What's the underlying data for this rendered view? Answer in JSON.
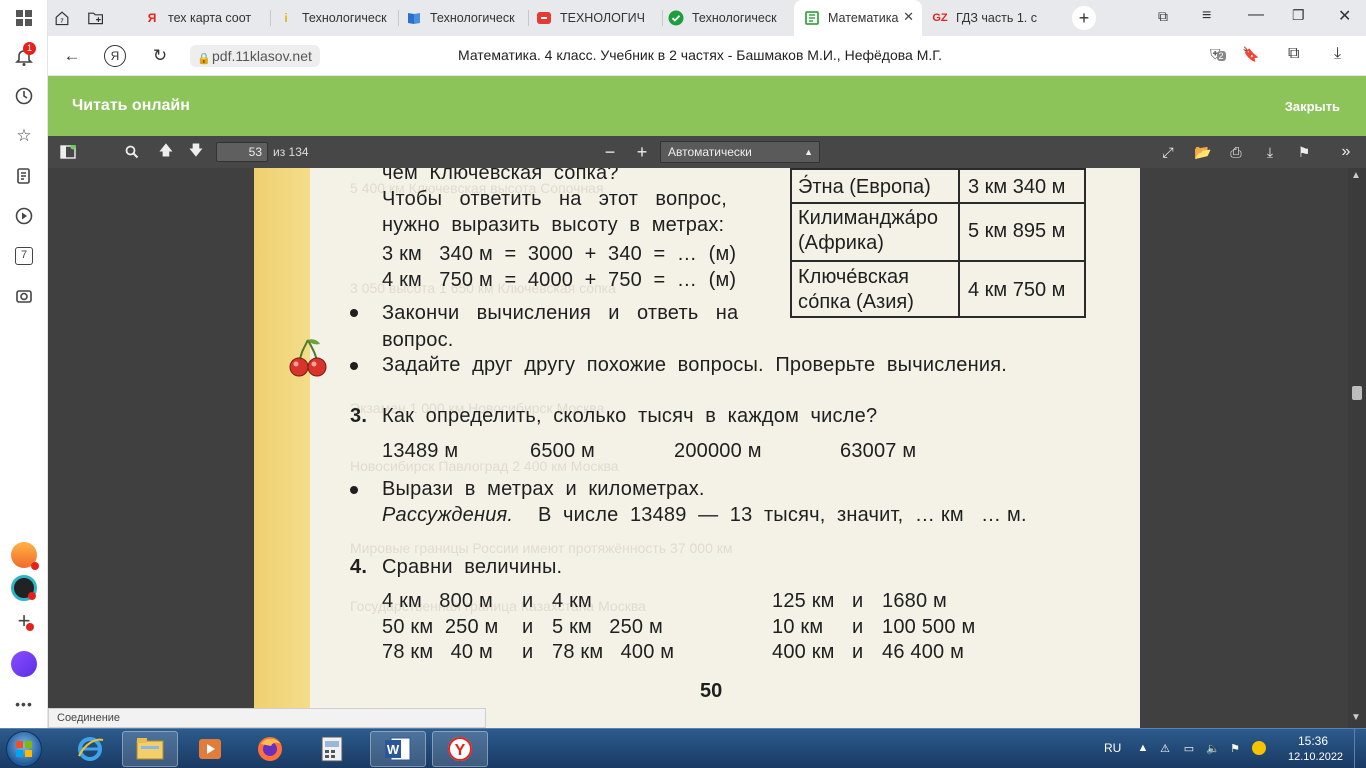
{
  "sidebar": {
    "notification_count": "1",
    "counter_label": "7"
  },
  "tabs": [
    {
      "label": "",
      "icon": "home-tab"
    },
    {
      "label": "тех карта соот",
      "icon": "yandex-y"
    },
    {
      "label": "Технологическ",
      "icon": "info-i"
    },
    {
      "label": "Технологическ",
      "icon": "book"
    },
    {
      "label": "ТЕХНОЛОГИЧ",
      "icon": "red-box"
    },
    {
      "label": "Технологическ",
      "icon": "green-check"
    },
    {
      "label": "Математика",
      "icon": "green-book",
      "active": true
    },
    {
      "label": "ГДЗ часть 1. с",
      "icon": "gdz"
    }
  ],
  "address": {
    "url": "pdf.11klasov.net",
    "title": "Математика. 4 класс. Учебник в 2 частях - Башмаков М.И., Нефёдова М.Г.",
    "lock_badge": "2"
  },
  "header": {
    "title": "Читать онлайн",
    "close": "Закрыть"
  },
  "pdf_toolbar": {
    "page": "53",
    "page_total": "из 134",
    "zoom": "Автоматически"
  },
  "book": {
    "lines": [
      "чем  Ключевская  сопка?",
      "Чтобы   ответить   на   этот   вопрос,",
      "нужно  выразить  высоту  в  метрах:",
      "3 км   340 м  =  3000  +  340  =  …  (м)",
      "4 км   750 м  =  4000  +  750  =  …  (м)",
      "Закончи   вычисления   и   ответь   на",
      "вопрос.",
      "Задайте  друг  другу  похожие  вопросы.  Проверьте  вычисления."
    ],
    "table": [
      {
        "name": "Э́тна (Европа)",
        "height": "3 км 340 м"
      },
      {
        "name": "Килиманджа́ро\n(Африка)",
        "height": "5 км 895 м"
      },
      {
        "name": "Ключе́вская\nсо́пка (Азия)",
        "height": "4 км 750 м"
      }
    ],
    "task3_num": "3.",
    "task3_text": "Как  определить,  сколько  тысяч  в  каждом  числе?",
    "numbers": [
      "13489 м",
      "6500 м",
      "200000 м",
      "63007 м"
    ],
    "bullet3": "Вырази  в  метрах  и  километрах.",
    "reasoning_label": "Рассуждения.",
    "reasoning_text": "В  числе  13489  —  13  тысяч,  значит,  … км   … м.",
    "task4_num": "4.",
    "task4_text": "Сравни  величины.",
    "compare_left": [
      [
        "4 км   800 м",
        "и",
        "4 км"
      ],
      [
        "50 км  250 м",
        "и",
        "5 км   250 м"
      ],
      [
        "78 км   40 м",
        "и",
        "78 км   400 м"
      ]
    ],
    "compare_right": [
      [
        "125 км",
        "и",
        "1680 м"
      ],
      [
        "10 км",
        "и",
        "100 500 м"
      ],
      [
        "400 км",
        "и",
        "46 400 м"
      ]
    ],
    "page_number": "50"
  },
  "status": "Соединение",
  "taskbar": {
    "lang": "RU",
    "time": "15:36",
    "date": "12.10.2022"
  },
  "colors": {
    "accent_green": "#8cc45a",
    "pdf_toolbar": "#474747",
    "page_bg": "#f4f1e6",
    "taskbar": "#1f4673"
  }
}
